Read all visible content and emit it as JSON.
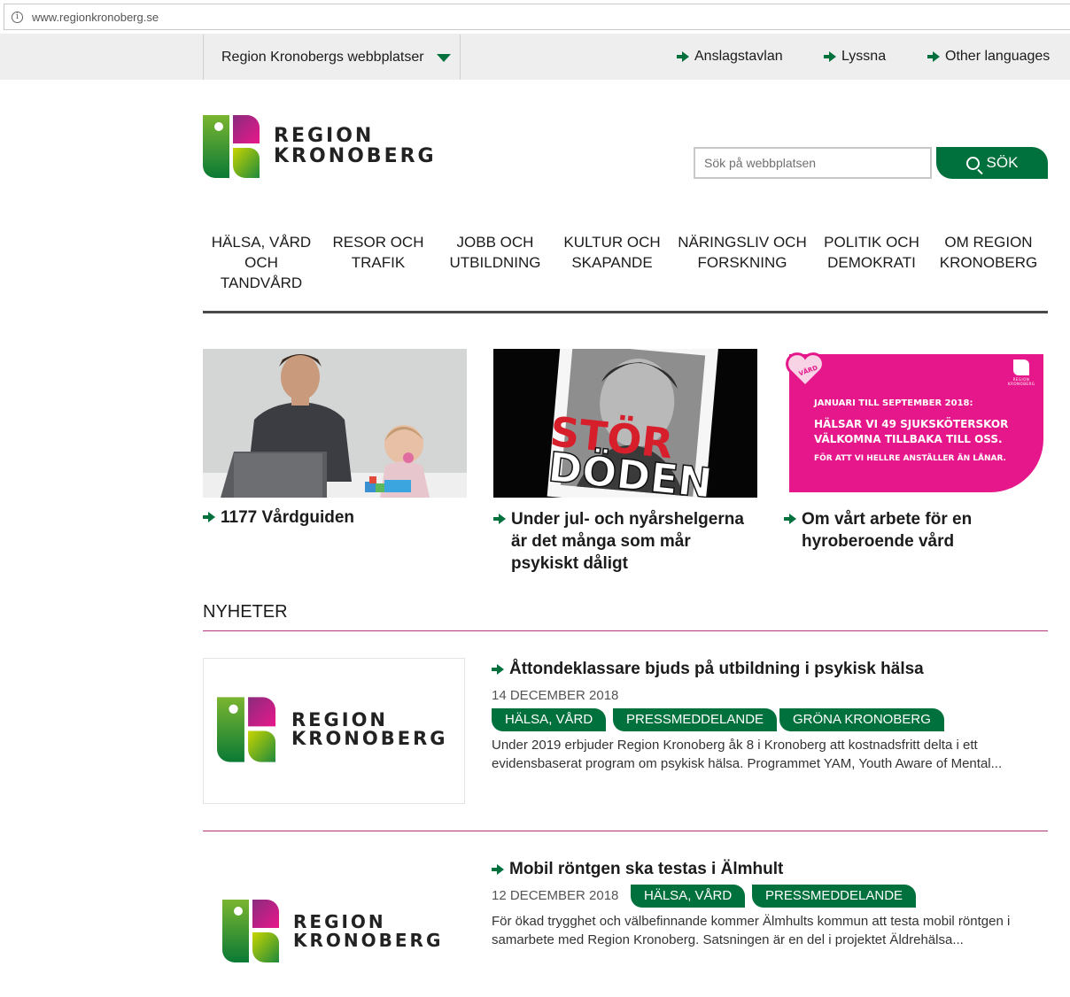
{
  "browser": {
    "url": "www.regionkronoberg.se",
    "info_icon": "info-icon"
  },
  "topbar": {
    "sites_dropdown": "Region Kronobergs webbplatser",
    "links": [
      {
        "label": "Anslagstavlan",
        "icon": "arrow-right-icon"
      },
      {
        "label": "Lyssna",
        "icon": "arrow-right-icon"
      },
      {
        "label": "Other languages",
        "icon": "arrow-right-icon"
      }
    ]
  },
  "logo": {
    "line1": "REGION",
    "line2": "KRONOBERG"
  },
  "search": {
    "placeholder": "Sök på webbplatsen",
    "button_label": "SÖK"
  },
  "nav": [
    {
      "label": "HÄLSA, VÅRD OCH TANDVÅRD"
    },
    {
      "label": "RESOR OCH TRAFIK"
    },
    {
      "label": "JOBB OCH UTBILDNING"
    },
    {
      "label": "KULTUR OCH SKAPANDE"
    },
    {
      "label": "NÄRINGSLIV OCH FORSKNING"
    },
    {
      "label": "POLITIK OCH DEMOKRATI"
    },
    {
      "label": "OM REGION KRONOBERG"
    }
  ],
  "promos": [
    {
      "link": "1177 Vårdguiden"
    },
    {
      "link": "Under jul- och nyårshelgerna är det många som mår psykiskt dåligt",
      "image_text_1": "STÖR",
      "image_text_2": "DÖDEN"
    },
    {
      "link": "Om vårt arbete för en hyroberoende vård",
      "image_lines": [
        "JANUARI TILL SEPTEMBER 2018:",
        "HÄLSAR VI 49 SJUKSKÖTERSKOR",
        "VÄLKOMNA TILLBAKA TILL OSS.",
        "FÖR ATT VI HELLRE ANSTÄLLER ÄN LÅNAR."
      ],
      "badge": "VÅRD",
      "mini_logo_line1": "REGION",
      "mini_logo_line2": "KRONOBERG"
    }
  ],
  "news": {
    "heading": "NYHETER",
    "items": [
      {
        "title": "Åttondeklassare bjuds på utbildning i psykisk hälsa",
        "date": "14 DECEMBER 2018",
        "tags": [
          "HÄLSA, VÅRD",
          "PRESSMEDDELANDE",
          "GRÖNA KRONOBERG"
        ],
        "excerpt": "Under 2019 erbjuder Region Kronoberg åk 8 i Kronoberg att kostnadsfritt delta i ett evidensbaserat program om psykisk hälsa. Programmet YAM, Youth Aware of Mental..."
      },
      {
        "title": "Mobil röntgen ska testas i Älmhult",
        "date": "12 DECEMBER 2018",
        "tags": [
          "HÄLSA, VÅRD",
          "PRESSMEDDELANDE"
        ],
        "excerpt": "För ökad trygghet och välbefinnande kommer Älmhults kommun att testa mobil röntgen i samarbete med Region Kronoberg. Satsningen är en del i projektet Äldrehälsa..."
      }
    ]
  },
  "colors": {
    "brand_green": "#00703c",
    "accent_magenta": "#e6178a",
    "rule_magenta": "#b5367a"
  }
}
